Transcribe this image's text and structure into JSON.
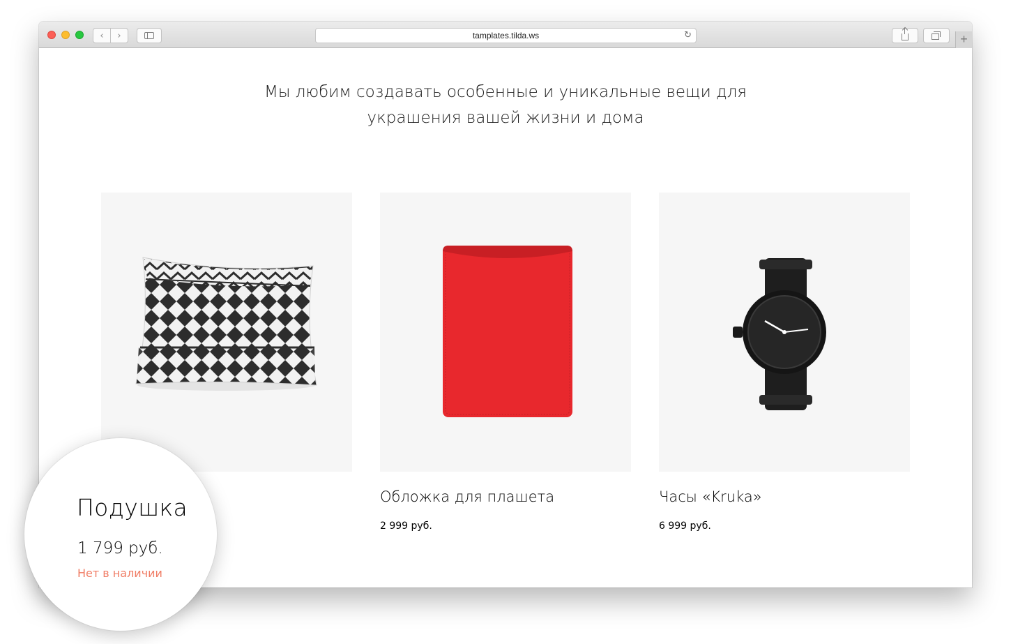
{
  "browser": {
    "url": "tamplates.tilda.ws",
    "icons": {
      "back": "chevron-left-icon",
      "forward": "chevron-right-icon",
      "sidebar": "sidebar-icon",
      "reload": "reload-icon",
      "share": "share-icon",
      "tabs": "tabs-overview-icon",
      "new_tab": "plus-icon"
    },
    "glyphs": {
      "back": "‹",
      "forward": "›",
      "reload": "↻",
      "new_tab": "+"
    }
  },
  "page": {
    "tagline": {
      "line1": "Мы любим создавать особенные и уникальные вещи для",
      "line2": "украшения вашей жизни и дома"
    },
    "products": [
      {
        "title": "Подушка",
        "price": "1 799 руб.",
        "stock": "Нет в наличии",
        "image": "pillow-image"
      },
      {
        "title": "Обложка для плашета",
        "price": "2 999 руб.",
        "image": "red-tablet-sleeve-image"
      },
      {
        "title": "Часы «Kruka»",
        "price": "6 999 руб.",
        "image": "black-watch-image"
      }
    ]
  },
  "colors": {
    "out_of_stock": "#f07c64",
    "sleeve_red": "#e8282d",
    "image_bg": "#f6f6f6"
  }
}
